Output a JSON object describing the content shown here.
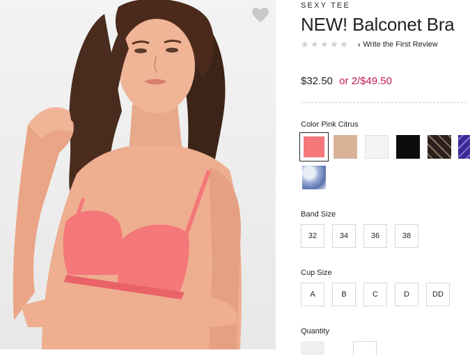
{
  "product": {
    "collection": "SEXY TEE",
    "title": "NEW! Balconet Bra",
    "rating_stars": 0,
    "review_link": "Write the First Review",
    "price": "$32.50",
    "offer": "or 2/$49.50"
  },
  "color": {
    "label": "Color Pink Citrus",
    "swatches": [
      {
        "name": "Pink Citrus",
        "color": "#f47779",
        "selected": true
      },
      {
        "name": "Nude",
        "color": "#d8b397"
      },
      {
        "name": "White",
        "color": "#f3f3f3"
      },
      {
        "name": "Black",
        "color": "#0d0d0d"
      },
      {
        "name": "Black Lace Print",
        "color": "#3a2d2a"
      },
      {
        "name": "Purple Print",
        "color": "#5a3fa8"
      },
      {
        "name": "Blue Tie Dye",
        "color": "#7e95c4"
      }
    ]
  },
  "band_size": {
    "label": "Band Size",
    "options": [
      "32",
      "34",
      "36",
      "38"
    ]
  },
  "cup_size": {
    "label": "Cup Size",
    "options": [
      "A",
      "B",
      "C",
      "D",
      "DD"
    ]
  },
  "quantity": {
    "label": "Quantity"
  },
  "icons": {
    "wishlist": "heart-icon",
    "review_chevron": "chevron-right-icon",
    "star": "star-icon"
  },
  "colors": {
    "sale_text": "#c2185b",
    "border": "#d6d6d6",
    "star_empty": "#cfcfcf"
  }
}
